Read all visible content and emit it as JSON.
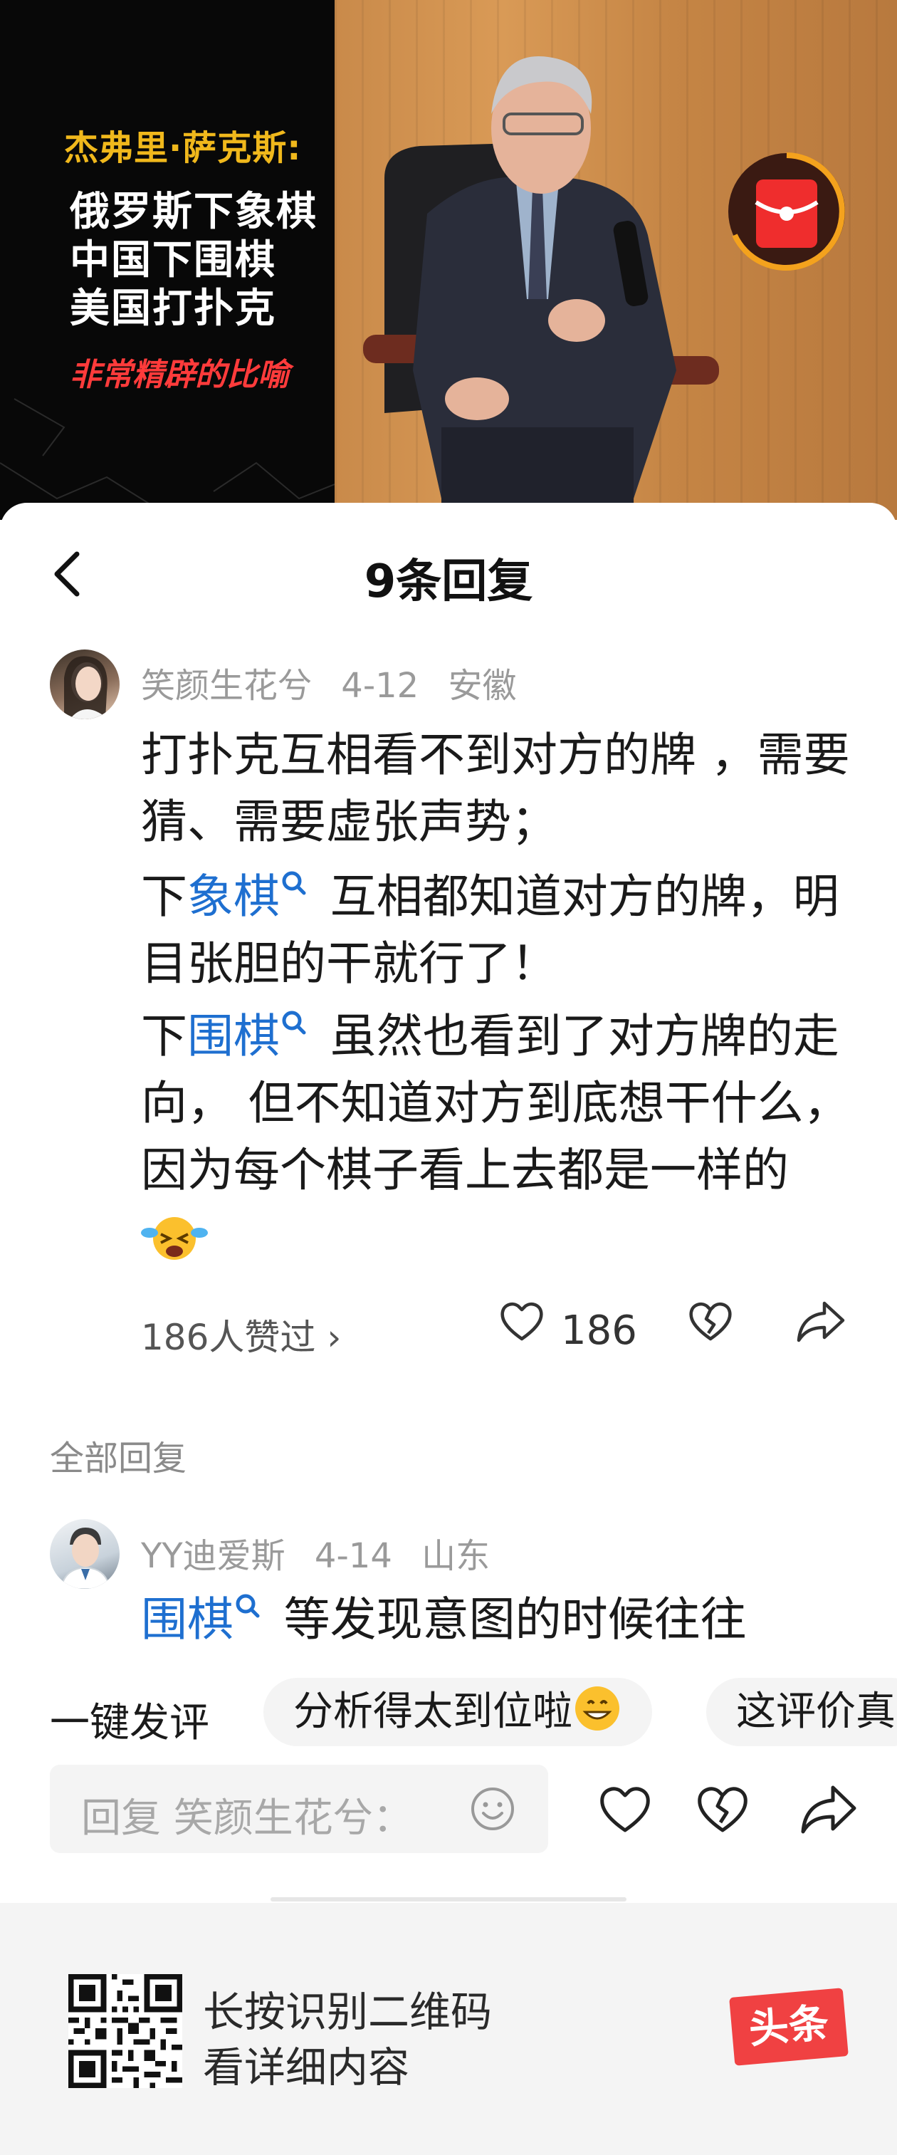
{
  "video": {
    "overlay_speaker": "杰弗里·萨克斯:",
    "overlay_lines": [
      "俄罗斯下象棋",
      "中国下围棋",
      "美国打扑克"
    ],
    "overlay_tag": "非常精辟的比喻"
  },
  "header": {
    "title": "9条回复"
  },
  "main_comment": {
    "author": "笑颜生花兮",
    "date": "4-12",
    "location": "安徽",
    "line1": "打扑克互相看不到对方的牌 ，需要猜、需要虚张声势；",
    "p2_prefix": "下",
    "p2_keyword": "象棋",
    "p2_rest": " 互相都知道对方的牌，明目张胆的干就行了！",
    "p3_prefix": "下",
    "p3_keyword": "围棋",
    "p3_rest": " 虽然也看到了对方牌的走向， 但不知道对方到底想干什么，因为每个棋子看上去都是一样的",
    "liked_by": "186人赞过 ›",
    "like_count": "186"
  },
  "section_label": "全部回复",
  "reply": {
    "author": "YY迪爱斯",
    "date": "4-14",
    "location": "山东",
    "keyword": "围棋",
    "text": " 等发现意图的时候往往"
  },
  "quick_reply": {
    "label": "一键发评",
    "chips": [
      "分析得太到位啦",
      "这评价真"
    ]
  },
  "reply_input": {
    "placeholder": "回复 笑颜生花兮："
  },
  "footer": {
    "line1": "长按识别二维码",
    "line2": "看详细内容",
    "brand": "头条"
  },
  "colors": {
    "link": "#1e6fd0",
    "brand_red": "#f04142",
    "overlay_yellow": "#f0b81c",
    "overlay_red": "#ff3b3b"
  }
}
